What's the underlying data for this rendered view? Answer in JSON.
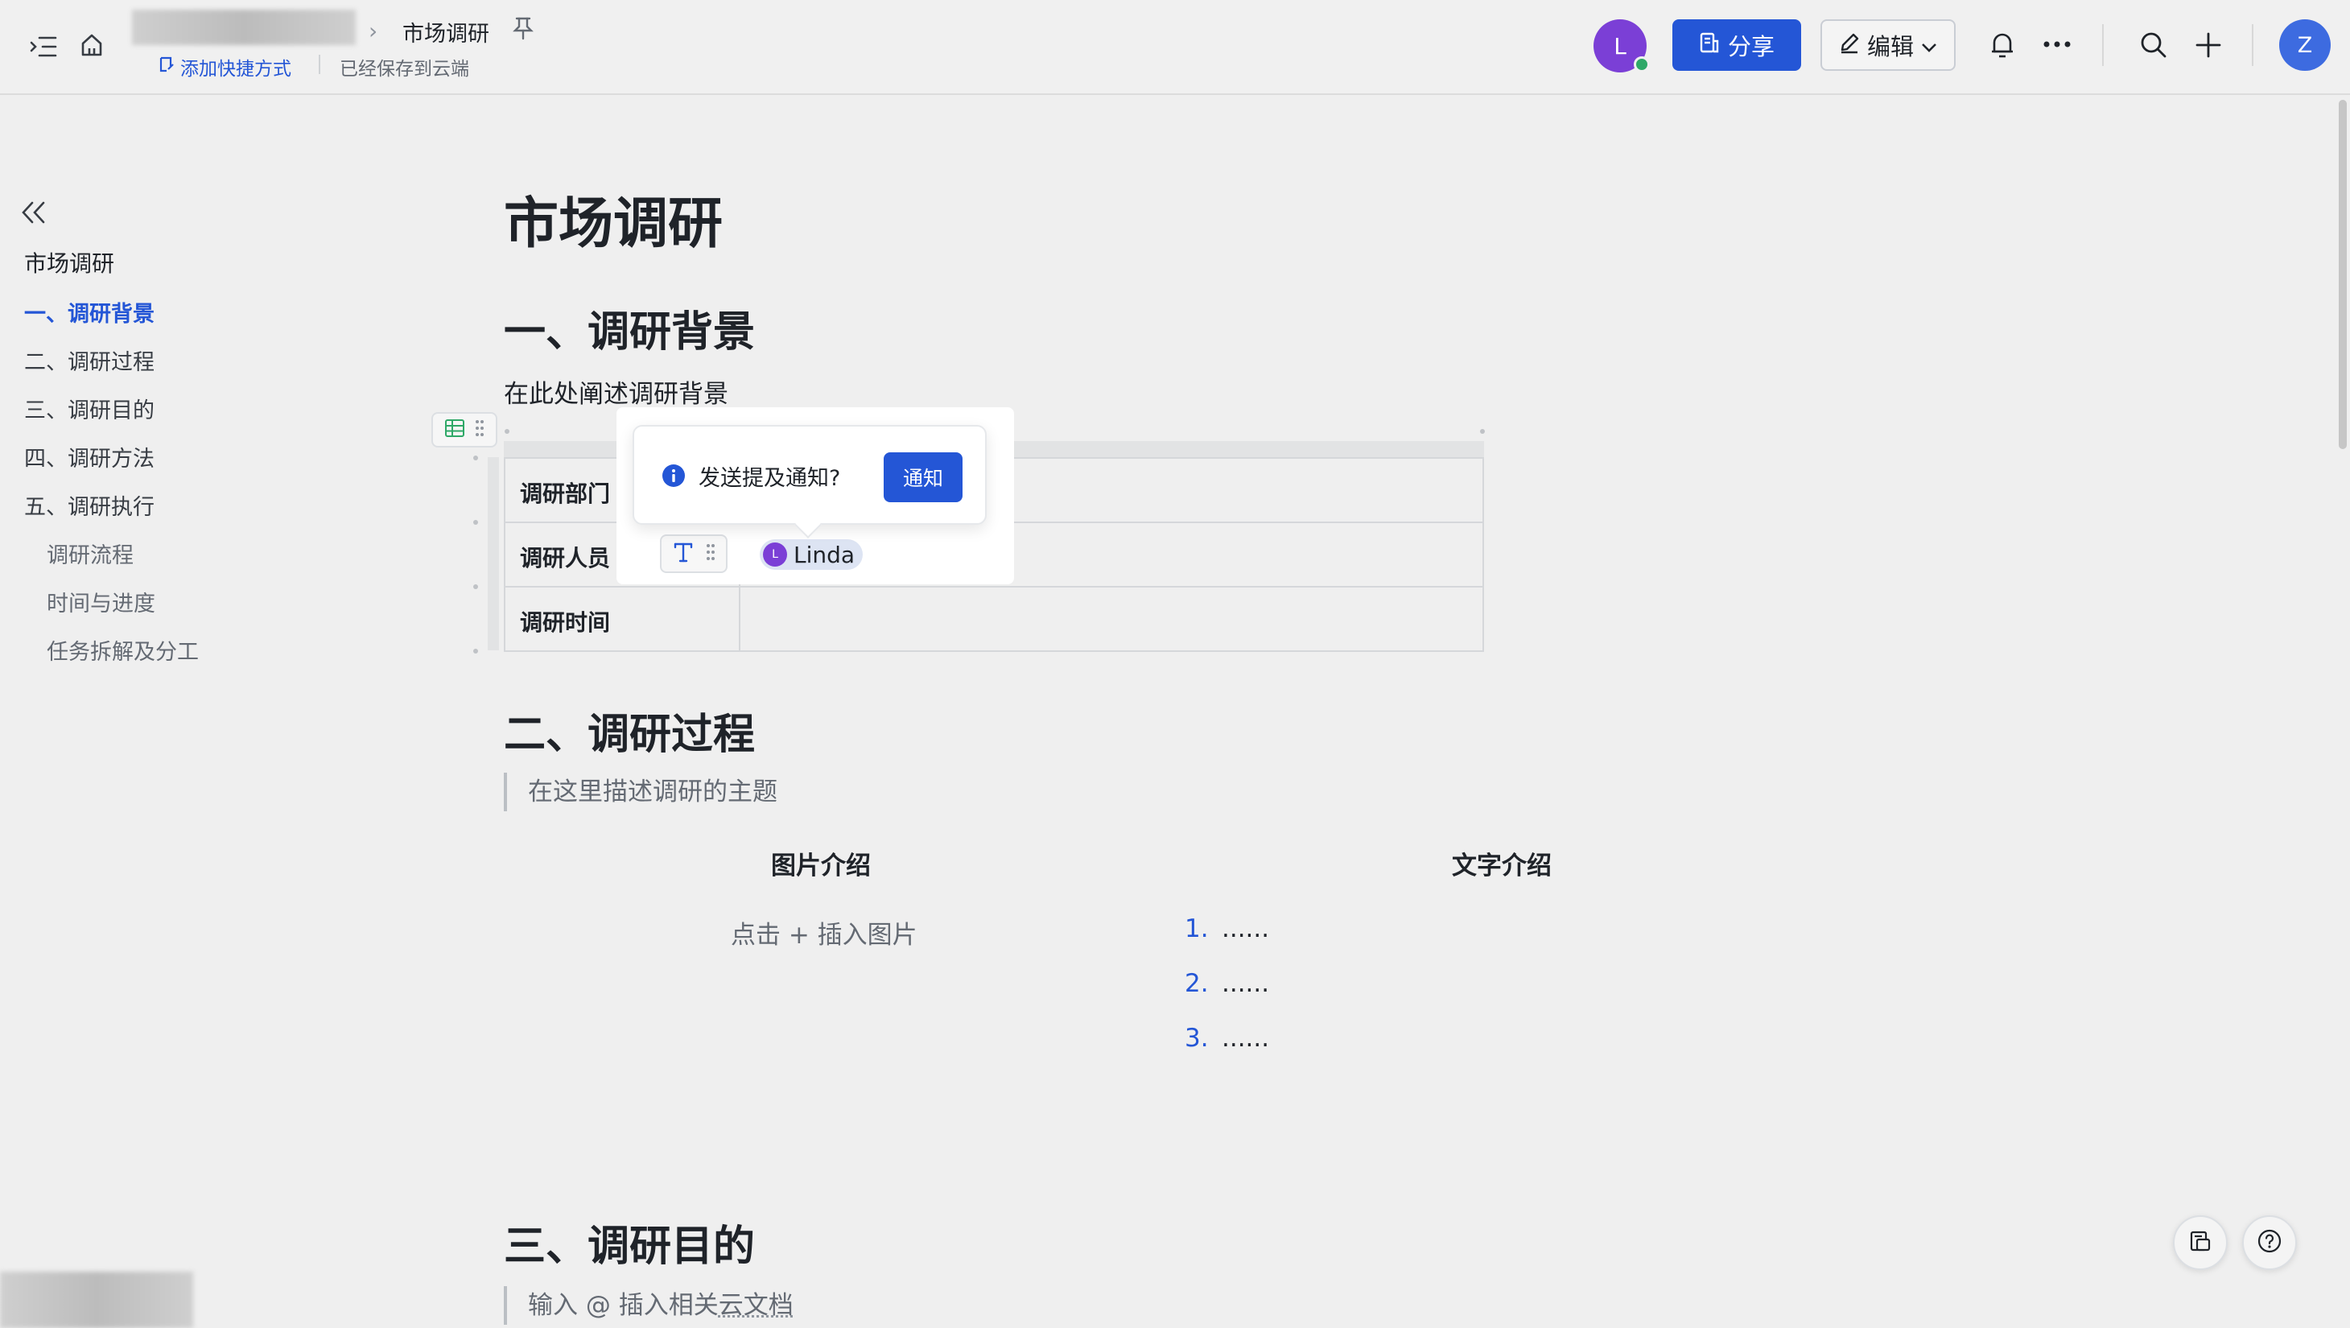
{
  "header": {
    "breadcrumb_separator": "›",
    "doc_title": "市场调研",
    "add_shortcut": "添加快捷方式",
    "saved_status": "已经保存到云端",
    "user_avatar_letter": "L",
    "share_label": "分享",
    "edit_label": "编辑",
    "profile_letter": "Z"
  },
  "outline": {
    "root": "市场调研",
    "items": [
      {
        "label": "一、调研背景"
      },
      {
        "label": "二、调研过程"
      },
      {
        "label": "三、调研目的"
      },
      {
        "label": "四、调研方法"
      },
      {
        "label": "五、调研执行"
      },
      {
        "label": "调研流程"
      },
      {
        "label": "时间与进度"
      },
      {
        "label": "任务拆解及分工"
      }
    ]
  },
  "document": {
    "title": "市场调研",
    "section1": {
      "heading": "一、调研背景",
      "paragraph": "在此处阐述调研背景",
      "table": {
        "rows": [
          {
            "label": "调研部门"
          },
          {
            "label": "调研人员",
            "mention": "Linda",
            "mention_letter": "L"
          },
          {
            "label": "调研时间"
          }
        ]
      }
    },
    "popover": {
      "text": "发送提及通知?",
      "button": "通知"
    },
    "section2": {
      "heading": "二、调研过程",
      "quote": "在这里描述调研的主题",
      "left_col_title": "图片介绍",
      "insert_image": "点击 + 插入图片",
      "right_col_title": "文字介绍",
      "list": [
        {
          "num": "1.",
          "text": "......"
        },
        {
          "num": "2.",
          "text": "......"
        },
        {
          "num": "3.",
          "text": "......"
        }
      ]
    },
    "section3": {
      "heading": "三、调研目的",
      "quote_prefix": "输入 @ 插入相关",
      "quote_link": "云文档"
    }
  },
  "colors": {
    "accent": "#2456d6",
    "avatar_purple": "#7b3fd6",
    "online": "#2ea867"
  },
  "icons": [
    "outline-toggle-icon",
    "home-icon",
    "pin-icon",
    "shortcut-icon",
    "share-doc-icon",
    "pencil-icon",
    "chevron-down-icon",
    "bell-icon",
    "more-icon",
    "search-icon",
    "plus-icon",
    "collapse-icon",
    "table-icon",
    "drag-handle-icon",
    "text-format-icon",
    "info-icon",
    "doc-outline-icon",
    "help-icon"
  ]
}
